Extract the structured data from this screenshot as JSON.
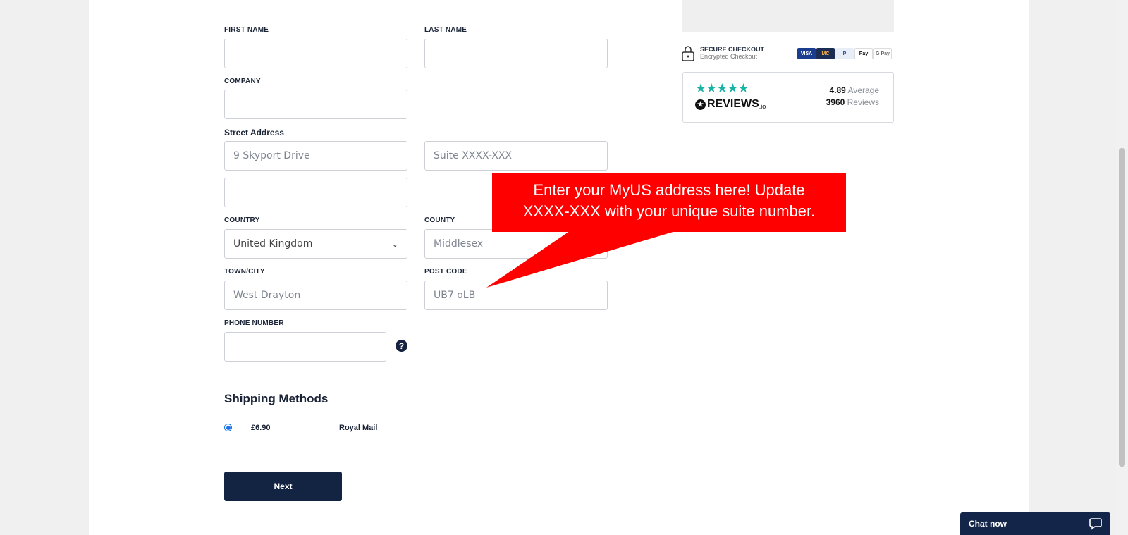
{
  "form": {
    "first_name_label": "FIRST NAME",
    "first_name_value": "",
    "last_name_label": "LAST NAME",
    "last_name_value": "",
    "company_label": "COMPANY",
    "company_value": "",
    "street_label": "Street Address",
    "street_line1_placeholder": "9 Skyport Drive",
    "street_suite_placeholder": "Suite XXXX-XXX",
    "street_line2_value": "",
    "country_label": "COUNTRY",
    "country_value": "United Kingdom",
    "county_label": "COUNTY",
    "county_placeholder": "Middlesex",
    "town_label": "TOWN/CITY",
    "town_placeholder": "West Drayton",
    "postcode_label": "POST CODE",
    "postcode_placeholder": "UB7 oLB",
    "phone_label": "PHONE NUMBER",
    "phone_value": "",
    "help_symbol": "?"
  },
  "shipping": {
    "heading": "Shipping Methods",
    "price": "£6.90",
    "carrier": "Royal Mail",
    "selected": true
  },
  "next_label": "Next",
  "secure": {
    "title": "SECURE CHECKOUT",
    "subtitle": "Encrypted Checkout",
    "cards": [
      "VISA",
      "MC",
      "P",
      "Pay",
      "G Pay"
    ]
  },
  "reviews": {
    "stars": "★★★★★",
    "logo_text": "REVIEWS",
    "logo_suffix": ".io",
    "rating": "4.89",
    "rating_label": "Average",
    "count": "3960",
    "count_label": "Reviews"
  },
  "callout": {
    "line1": "Enter your MyUS address here! Update",
    "line2": "XXXX-XXX with your unique suite number.",
    "color": "#ff0000"
  },
  "chat_label": "Chat now",
  "colors": {
    "primary": "#132342",
    "accent_star": "#19b3a6",
    "radio": "#1a73e8"
  }
}
